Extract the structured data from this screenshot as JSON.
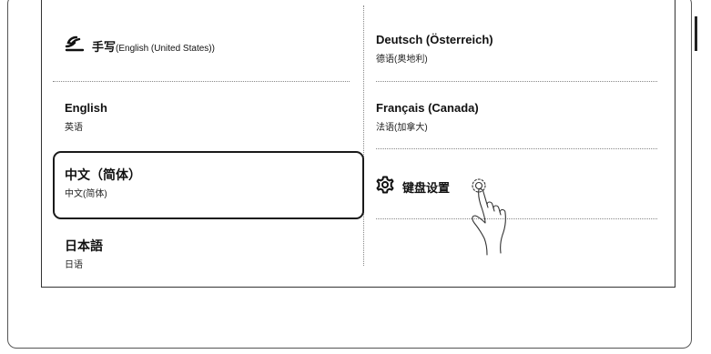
{
  "languages": {
    "handwriting": {
      "label": "手写",
      "paren": "(English (United States))"
    },
    "english": {
      "title": "English",
      "subtitle": "英语"
    },
    "chinese_simplified": {
      "title": "中文（简体）",
      "subtitle": "中文(简体)"
    },
    "japanese": {
      "title": "日本語",
      "subtitle": "日语"
    },
    "german_austria": {
      "title": "Deutsch (Österreich)",
      "subtitle": "德语(奥地利)"
    },
    "french_canada": {
      "title": "Français (Canada)",
      "subtitle": "法语(加拿大)"
    }
  },
  "settings": {
    "label": "键盘设置",
    "icon": "gear-icon"
  },
  "gesture": {
    "icon": "tap-hand-icon"
  },
  "selected": "chinese_simplified"
}
